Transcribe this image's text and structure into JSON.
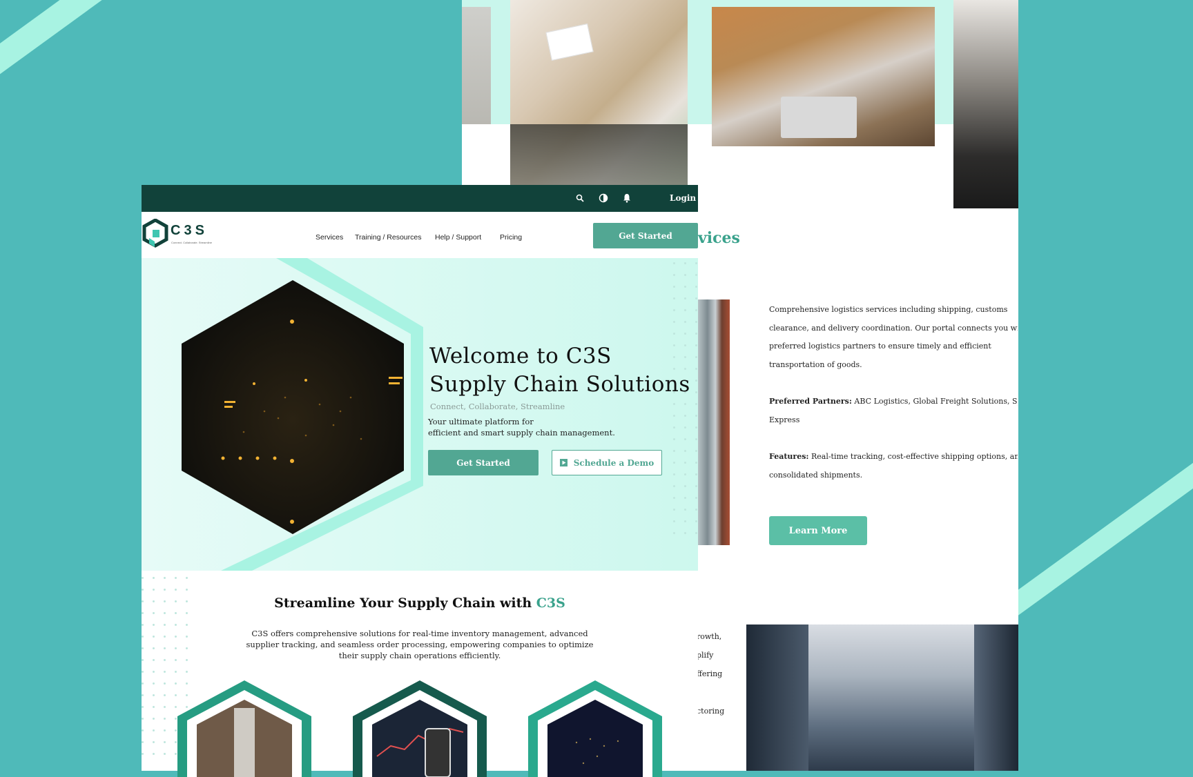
{
  "topbar": {
    "login_label": "Login"
  },
  "nav": {
    "logo_text": "C3S",
    "logo_tagline": "Connect. Collaborate. Streamline",
    "links": [
      "Services",
      "Training / Resources",
      "Help / Support",
      "Pricing"
    ],
    "cta_label": "Get Started"
  },
  "hero": {
    "title_line1": "Welcome to C3S",
    "title_line2": "Supply Chain Solutions",
    "tagline": "Connect, Collaborate, Streamline",
    "desc_line1": "Your ultimate platform for",
    "desc_line2": "efficient and smart supply chain management.",
    "primary_label": "Get Started",
    "secondary_label": "Schedule a Demo"
  },
  "streamline": {
    "heading_prefix": "Streamline Your Supply Chain with ",
    "heading_brand": "C3S",
    "body_line1": "C3S offers comprehensive solutions for real-time inventory management, advanced",
    "body_line2": "supplier tracking, and seamless order processing, empowering companies to optimize",
    "body_line3": "their supply chain operations efficiently."
  },
  "back_page": {
    "section_heading_fragment": "vices",
    "service_desc_line1": "Comprehensive logistics services including shipping, customs",
    "service_desc_line2": "clearance, and delivery coordination. Our portal connects you wi",
    "service_desc_line3": "preferred logistics partners to ensure timely and efficient",
    "service_desc_line4": "transportation of goods.",
    "partners_label": "Preferred Partners:",
    "partners_text": " ABC Logistics, Global Freight Solutions, Speec",
    "partners_text2": "Express",
    "features_label": "Features:",
    "features_text": " Real-time tracking, cost-effective shipping options, and",
    "features_text2": "consolidated shipments.",
    "learn_more_label": "Learn More",
    "fragments": [
      "rowth,",
      "plify",
      "ffering",
      "ctoring"
    ]
  },
  "colors": {
    "background": "#4fbab9",
    "accent": "#52a793",
    "dark": "#11423a",
    "mint": "#a8f3e2"
  }
}
